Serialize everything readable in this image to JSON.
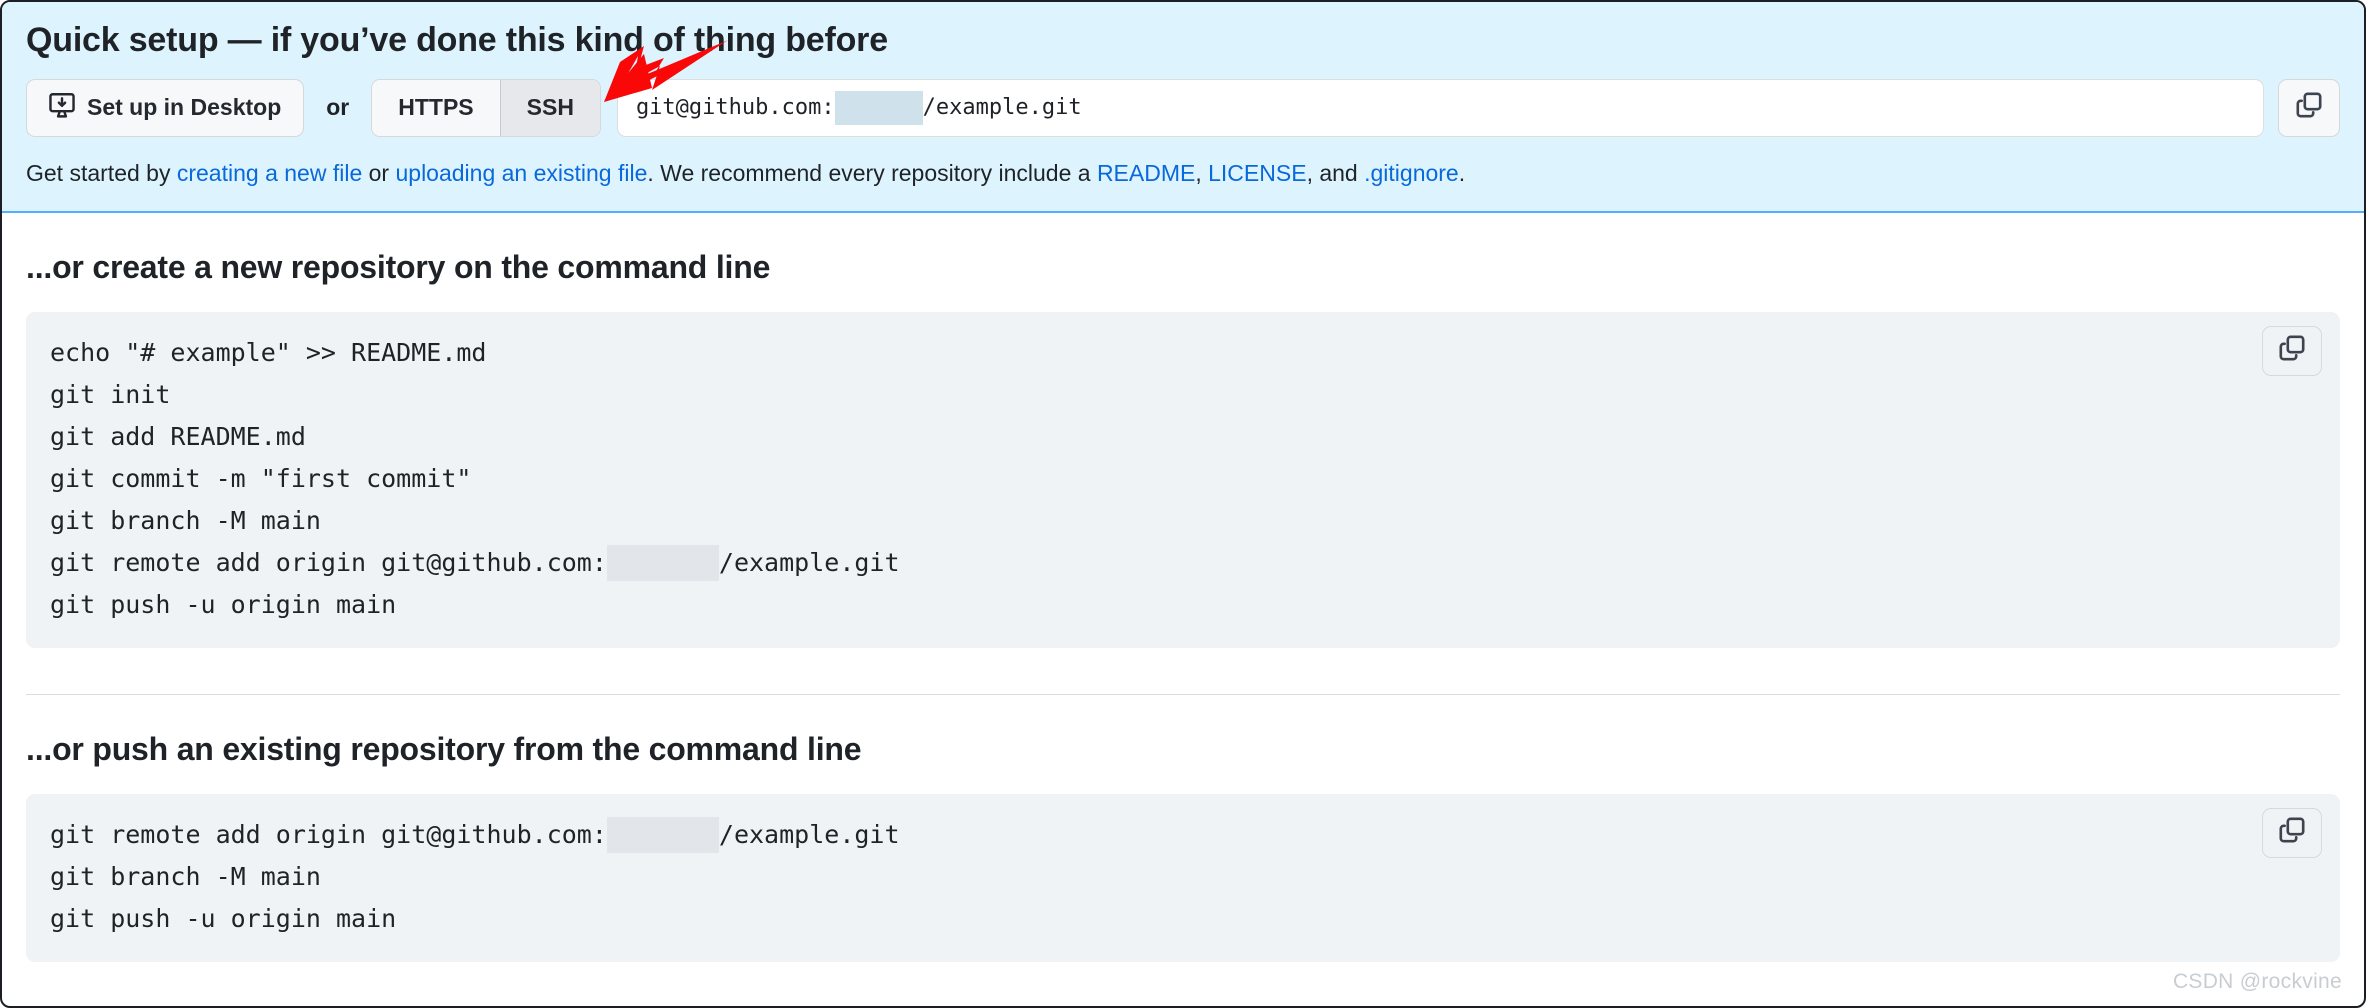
{
  "quick_setup": {
    "title": "Quick setup — if you’ve done this kind of thing before",
    "desktop_button": "Set up in Desktop",
    "or_label": "or",
    "protocols": [
      {
        "label": "HTTPS",
        "active": false
      },
      {
        "label": "SSH",
        "active": true
      }
    ],
    "clone_url": {
      "prefix": "git@github.com:",
      "redacted": "",
      "suffix": "/example.git"
    },
    "copy_icon": "copy-icon",
    "desktop_icon": "desktop-download-icon",
    "get_started": {
      "lead": "Get started by ",
      "link_create": "creating a new file",
      "mid_or": " or ",
      "link_upload": "uploading an existing file",
      "mid_recommend": ". We recommend every repository include a ",
      "link_readme": "README",
      "comma_1": ", ",
      "link_license": "LICENSE",
      "and_text": ", and ",
      "link_gitignore": ".gitignore",
      "period": "."
    }
  },
  "section_create": {
    "title": "...or create a new repository on the command line",
    "lines": [
      {
        "text": "echo \"# example\" >> README.md",
        "redacted": false
      },
      {
        "text": "git init",
        "redacted": false
      },
      {
        "text": "git add README.md",
        "redacted": false
      },
      {
        "text": "git commit -m \"first commit\"",
        "redacted": false
      },
      {
        "text": "git branch -M main",
        "redacted": false
      },
      {
        "prefix": "git remote add origin git@github.com:",
        "suffix": "/example.git",
        "redacted": true
      },
      {
        "text": "git push -u origin main",
        "redacted": false
      }
    ],
    "copy_label": "copy-icon"
  },
  "section_push": {
    "title": "...or push an existing repository from the command line",
    "lines": [
      {
        "prefix": "git remote add origin git@github.com:",
        "suffix": "/example.git",
        "redacted": true
      },
      {
        "text": "git branch -M main",
        "redacted": false
      },
      {
        "text": "git push -u origin main",
        "redacted": false
      }
    ],
    "copy_label": "copy-icon"
  },
  "annotation": {
    "arrow_color": "#fa0808",
    "arrow_target": "SSH"
  },
  "watermark": "CSDN @rockvine",
  "colors": {
    "banner_bg": "#ddf4ff",
    "banner_border": "#54aeff",
    "link": "#0969da",
    "code_bg": "#f0f3f6",
    "text": "#1f2328"
  }
}
